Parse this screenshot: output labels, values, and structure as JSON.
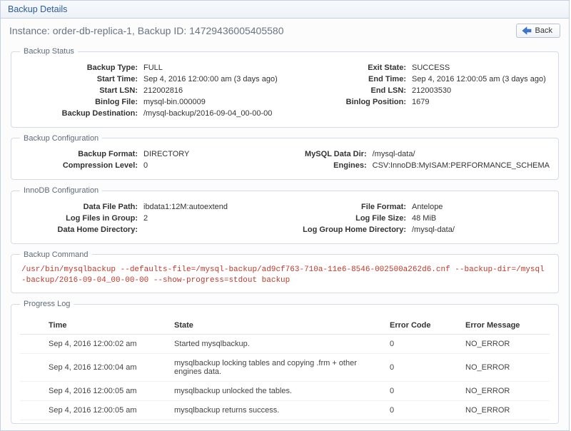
{
  "header": {
    "title": "Backup Details",
    "instance_line": "Instance: order-db-replica-1, Backup ID: 14729436005405580",
    "back_label": "Back"
  },
  "backup_status": {
    "legend": "Backup Status",
    "left": {
      "backup_type_label": "Backup Type:",
      "backup_type": "FULL",
      "start_time_label": "Start Time:",
      "start_time": "Sep 4, 2016 12:00:00 am (3 days ago)",
      "start_lsn_label": "Start LSN:",
      "start_lsn": "212002816",
      "binlog_file_label": "Binlog File:",
      "binlog_file": "mysql-bin.000009",
      "backup_dest_label": "Backup Destination:",
      "backup_dest": "/mysql-backup/2016-09-04_00-00-00"
    },
    "right": {
      "exit_state_label": "Exit State:",
      "exit_state": "SUCCESS",
      "end_time_label": "End Time:",
      "end_time": "Sep 4, 2016 12:00:05 am (3 days ago)",
      "end_lsn_label": "End LSN:",
      "end_lsn": "212003530",
      "binlog_pos_label": "Binlog Position:",
      "binlog_pos": "1679"
    }
  },
  "backup_config": {
    "legend": "Backup Configuration",
    "left": {
      "format_label": "Backup Format:",
      "format": "DIRECTORY",
      "compression_label": "Compression Level:",
      "compression": "0"
    },
    "right": {
      "datadir_label": "MySQL Data Dir:",
      "datadir": "/mysql-data/",
      "engines_label": "Engines:",
      "engines": "CSV:InnoDB:MyISAM:PERFORMANCE_SCHEMA"
    }
  },
  "innodb_config": {
    "legend": "InnoDB Configuration",
    "left": {
      "data_file_path_label": "Data File Path:",
      "data_file_path": "ibdata1:12M:autoextend",
      "log_files_label": "Log Files in Group:",
      "log_files": "2",
      "data_home_label": "Data Home Directory:",
      "data_home": ""
    },
    "right": {
      "file_format_label": "File Format:",
      "file_format": "Antelope",
      "log_file_size_label": "Log File Size:",
      "log_file_size": "48 MiB",
      "log_group_home_label": "Log Group Home Directory:",
      "log_group_home": "/mysql-data/"
    }
  },
  "backup_command": {
    "legend": "Backup Command",
    "text": "/usr/bin/mysqlbackup --defaults-file=/mysql-backup/ad9cf763-710a-11e6-8546-002500a262d6.cnf --backup-dir=/mysql-backup/2016-09-04_00-00-00 --show-progress=stdout backup"
  },
  "progress_log": {
    "legend": "Progress Log",
    "headers": {
      "time": "Time",
      "state": "State",
      "error_code": "Error Code",
      "error_msg": "Error Message"
    },
    "rows": [
      {
        "time": "Sep 4, 2016 12:00:02 am",
        "state": "Started mysqlbackup.",
        "code": "0",
        "msg": "NO_ERROR"
      },
      {
        "time": "Sep 4, 2016 12:00:04 am",
        "state": "mysqlbackup locking tables and copying .frm + other engines data.",
        "code": "0",
        "msg": "NO_ERROR"
      },
      {
        "time": "Sep 4, 2016 12:00:05 am",
        "state": "mysqlbackup unlocked the tables.",
        "code": "0",
        "msg": "NO_ERROR"
      },
      {
        "time": "Sep 4, 2016 12:00:05 am",
        "state": "mysqlbackup returns success.",
        "code": "0",
        "msg": "NO_ERROR"
      }
    ]
  }
}
